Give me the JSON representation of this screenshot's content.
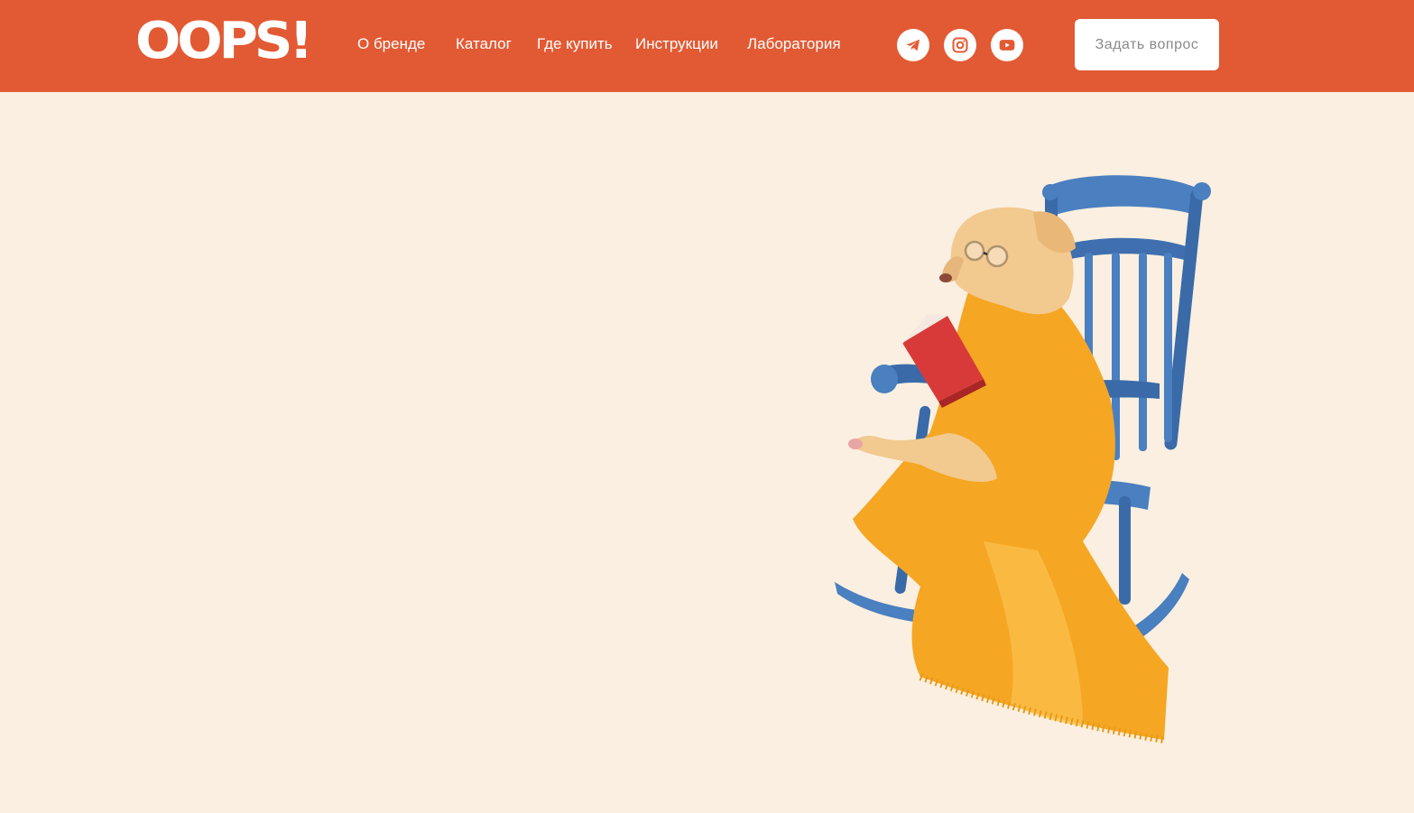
{
  "header": {
    "logo_text": "OOPS!",
    "nav": [
      {
        "label": "О бренде"
      },
      {
        "label": "Каталог"
      },
      {
        "label": "Где купить"
      },
      {
        "label": "Инструкции"
      },
      {
        "label": "Лаборатория"
      }
    ],
    "social": [
      {
        "icon": "telegram-icon"
      },
      {
        "icon": "instagram-icon"
      },
      {
        "icon": "youtube-icon"
      }
    ],
    "ask_button": "Задать вопрос"
  },
  "colors": {
    "header_bg": "#e25a34",
    "page_bg": "#faefe0",
    "chair_blue": "#4a7fc0",
    "blanket_orange": "#f5a623",
    "dog_fur": "#f2c98f",
    "book_red": "#d83a3a"
  }
}
